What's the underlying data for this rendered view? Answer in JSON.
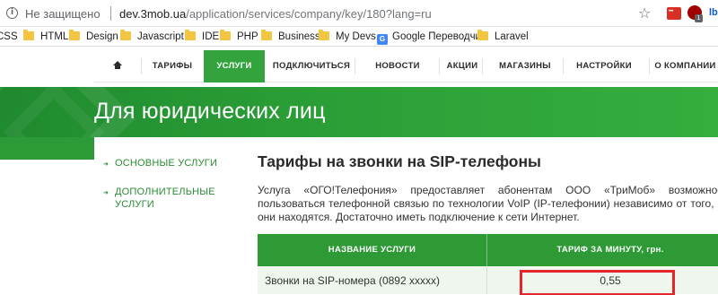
{
  "browser": {
    "security_label": "Не защищено",
    "url_host": "dev.3mob.ua",
    "url_path": "/application/services/company/key/180?lang=ru",
    "ext_badge": "1",
    "ext3_label": "lb"
  },
  "bookmarks": [
    {
      "label": "CSS",
      "icon": "folder-icon"
    },
    {
      "label": "HTML",
      "icon": "folder-icon"
    },
    {
      "label": "Design",
      "icon": "folder-icon"
    },
    {
      "label": "Javascript",
      "icon": "folder-icon"
    },
    {
      "label": "IDE",
      "icon": "folder-icon"
    },
    {
      "label": "PHP",
      "icon": "folder-icon"
    },
    {
      "label": "Business",
      "icon": "folder-icon"
    },
    {
      "label": "My Devs",
      "icon": "folder-icon"
    },
    {
      "label": "Google Переводчик",
      "icon": "google-translate-icon"
    },
    {
      "label": "Laravel",
      "icon": "folder-icon"
    }
  ],
  "nav": {
    "items": [
      {
        "label": "ТАРИФЫ"
      },
      {
        "label": "УСЛУГИ",
        "active": true
      },
      {
        "label": "ПОДКЛЮЧИТЬСЯ"
      },
      {
        "label": "НОВОСТИ"
      },
      {
        "label": "АКЦИИ"
      },
      {
        "label": "МАГАЗИНЫ"
      },
      {
        "label": "НАСТРОЙКИ"
      },
      {
        "label": "О КОМПАНИИ"
      }
    ]
  },
  "hero": {
    "title": "Для юридических лиц"
  },
  "sidebar": {
    "items": [
      {
        "label": "ОСНОВНЫЕ УСЛУГИ"
      },
      {
        "label_line1": "ДОПОЛНИТЕЛЬНЫЕ",
        "label_line2": "УСЛУГИ"
      }
    ]
  },
  "content": {
    "title": "Тарифы на звонки на SIP-телефоны",
    "text": "Услуга «ОГО!Телефония» предоставляет абонентам ООО «ТриМоб» возможность пользоваться телефонной связью по технологии VoIP (IP-телефонии) независимо от того, где они находятся. Достаточно иметь подключение к сети Интернет.",
    "table": {
      "headers": [
        "НАЗВАНИЕ УСЛУГИ",
        "ТАРИФ ЗА МИНУТУ, грн."
      ],
      "rows": [
        {
          "service": "Звонки на SIP-номера (0892 xxxxx)",
          "price": "0,55"
        }
      ]
    }
  },
  "colors": {
    "brand_green": "#33a33d",
    "highlight_red": "#e3262c"
  }
}
